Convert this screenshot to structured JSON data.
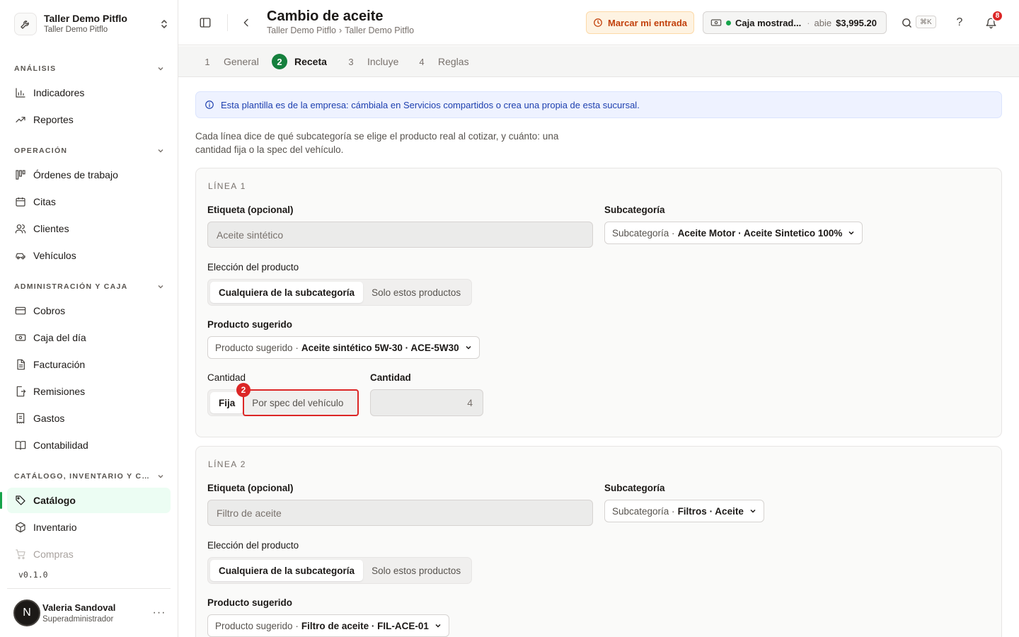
{
  "brand": {
    "name": "Taller Demo Pitflo",
    "subtitle": "Taller Demo Pitflo"
  },
  "sidebar": {
    "sections": [
      {
        "title": "ANÁLISIS",
        "items": [
          "Indicadores",
          "Reportes"
        ]
      },
      {
        "title": "OPERACIÓN",
        "items": [
          "Órdenes de trabajo",
          "Citas",
          "Clientes",
          "Vehículos"
        ]
      },
      {
        "title": "ADMINISTRACIÓN Y CAJA",
        "items": [
          "Cobros",
          "Caja del día",
          "Facturación",
          "Remisiones",
          "Gastos",
          "Contabilidad"
        ]
      },
      {
        "title": "CATÁLOGO, INVENTARIO Y CO...",
        "items": [
          "Catálogo",
          "Inventario",
          "Compras"
        ]
      }
    ],
    "active_item": "Catálogo",
    "version": "v0.1.0",
    "user": {
      "initial": "N",
      "name": "Valeria Sandoval",
      "role": "Superadministrador"
    }
  },
  "header": {
    "title": "Cambio de aceite",
    "breadcrumb": [
      "Taller Demo Pitflo",
      "›",
      "Taller Demo Pitflo"
    ],
    "mark_entry_label": "Marcar mi entrada",
    "cash": {
      "name": "Caja mostrad...",
      "separator": "·",
      "state": "abie",
      "amount": "$3,995.20"
    },
    "search_shortcut": "⌘K",
    "help_label": "?",
    "notifications_count": "8"
  },
  "steps": [
    {
      "n": "1",
      "label": "General"
    },
    {
      "n": "2",
      "label": "Receta"
    },
    {
      "n": "3",
      "label": "Incluye"
    },
    {
      "n": "4",
      "label": "Reglas"
    }
  ],
  "info_banner": "Esta plantilla es de la empresa: cámbiala en Servicios compartidos o crea una propia de esta sucursal.",
  "description": "Cada línea dice de qué subcategoría se elige el producto real al cotizar, y cuánto: una cantidad fija o la spec del vehículo.",
  "labels": {
    "label_optional": "Etiqueta (opcional)",
    "subcategory": "Subcategoría",
    "product_choice": "Elección del producto",
    "any_of_subcategory": "Cualquiera de la subcategoría",
    "only_these": "Solo estos productos",
    "suggested_product": "Producto sugerido",
    "quantity": "Cantidad",
    "fixed": "Fija",
    "by_vehicle_spec": "Por spec del vehículo",
    "subcategory_prefix": "Subcategoría ·",
    "suggested_prefix": "Producto sugerido ·"
  },
  "lines": [
    {
      "title": "LÍNEA 1",
      "label_value": "Aceite sintético",
      "subcategory": "Aceite Motor · Aceite Sintetico 100%",
      "suggested": "Aceite sintético 5W-30 · ACE-5W30",
      "quantity": "4"
    },
    {
      "title": "LÍNEA 2",
      "label_value": "Filtro de aceite",
      "subcategory": "Filtros · Aceite",
      "suggested": "Filtro de aceite · FIL-ACE-01"
    }
  ],
  "annotation_badge": "2",
  "colors": {
    "accent": "#15803d",
    "highlight": "#dc2626",
    "info_text": "#1e40af",
    "warn_text": "#c2410c"
  }
}
